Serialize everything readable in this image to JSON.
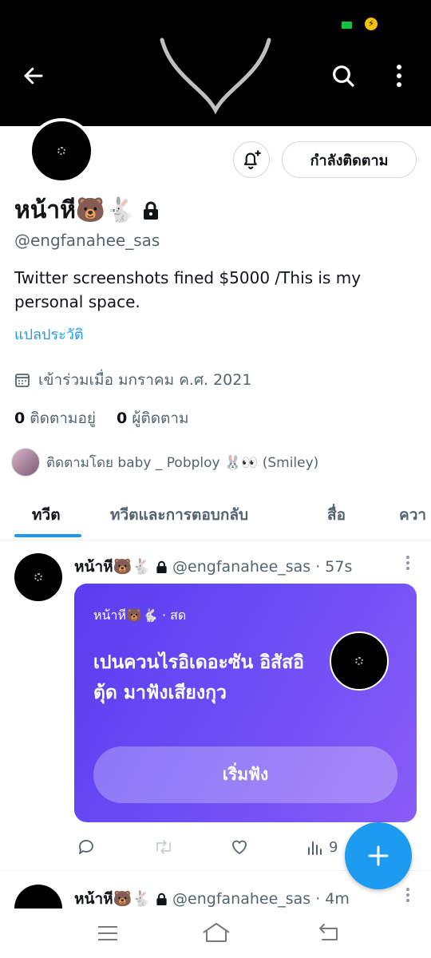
{
  "status": {
    "battery_color": "#19c23c",
    "charge_icon": "⚡"
  },
  "header": {
    "back_icon": "arrow-left-icon",
    "search_icon": "search-icon",
    "more_icon": "more-vertical-icon"
  },
  "profile": {
    "name": "หน้าหี🐻🐇",
    "protected_icon": "lock-icon",
    "handle": "@engfanahee_sas",
    "bio": "Twitter screenshots fined $5000 /This is my personal space.",
    "translate_bio": "แปลประวัติ",
    "joined": "เข้าร่วมเมื่อ มกราคม ค.ศ. 2021",
    "following_count": "0",
    "following_label": "ติดตามอยู่",
    "followers_count": "0",
    "followers_label": "ผู้ติดตาม",
    "followed_by": "ติดตามโดย baby _ Pobploy 🐰👀 (Smiley)"
  },
  "buttons": {
    "follow_label": "กำลังติดตาม",
    "notify_icon": "bell-plus-icon"
  },
  "tabs": [
    {
      "label": "ทวีต"
    },
    {
      "label": "ทวีตและการตอบกลับ"
    },
    {
      "label": "สื่อ"
    },
    {
      "label": "ควา"
    }
  ],
  "tweets": [
    {
      "name": "หน้าหี🐻🐇",
      "handle": "@engfanahee_sas",
      "time": "· 57s",
      "space": {
        "meta": "หน้าหี🐻🐇 · สด",
        "title": "เปนควนไรอิเดอะซัน อิสัสอิตุ้ด มาฟังเสียงกุว",
        "button": "เริ่มฟัง"
      },
      "views": "9"
    },
    {
      "name": "หน้าหี🐻🐇",
      "handle": "@engfanahee_sas",
      "time": "· 4m"
    }
  ],
  "fab_icon": "plus-icon",
  "nav": {
    "menu_icon": "menu-icon",
    "home_icon": "home-icon",
    "back_icon": "back-icon"
  }
}
